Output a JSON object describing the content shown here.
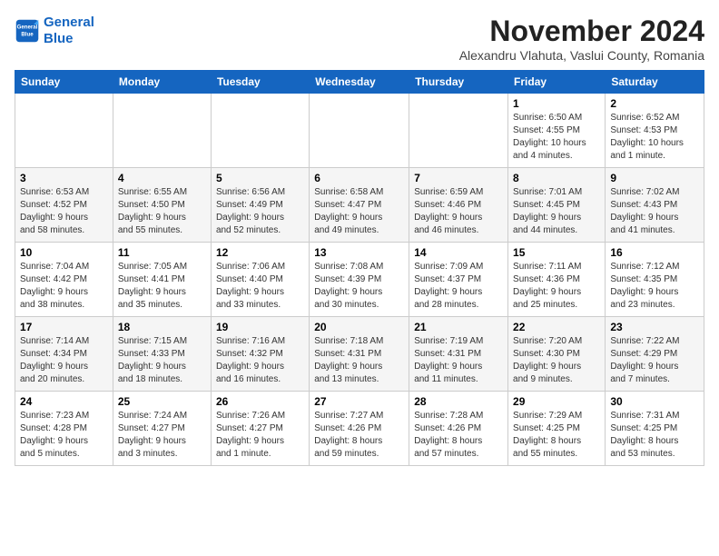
{
  "logo": {
    "line1": "General",
    "line2": "Blue"
  },
  "header": {
    "month": "November 2024",
    "location": "Alexandru Vlahuta, Vaslui County, Romania"
  },
  "weekdays": [
    "Sunday",
    "Monday",
    "Tuesday",
    "Wednesday",
    "Thursday",
    "Friday",
    "Saturday"
  ],
  "weeks": [
    [
      {
        "day": "",
        "detail": ""
      },
      {
        "day": "",
        "detail": ""
      },
      {
        "day": "",
        "detail": ""
      },
      {
        "day": "",
        "detail": ""
      },
      {
        "day": "",
        "detail": ""
      },
      {
        "day": "1",
        "detail": "Sunrise: 6:50 AM\nSunset: 4:55 PM\nDaylight: 10 hours\nand 4 minutes."
      },
      {
        "day": "2",
        "detail": "Sunrise: 6:52 AM\nSunset: 4:53 PM\nDaylight: 10 hours\nand 1 minute."
      }
    ],
    [
      {
        "day": "3",
        "detail": "Sunrise: 6:53 AM\nSunset: 4:52 PM\nDaylight: 9 hours\nand 58 minutes."
      },
      {
        "day": "4",
        "detail": "Sunrise: 6:55 AM\nSunset: 4:50 PM\nDaylight: 9 hours\nand 55 minutes."
      },
      {
        "day": "5",
        "detail": "Sunrise: 6:56 AM\nSunset: 4:49 PM\nDaylight: 9 hours\nand 52 minutes."
      },
      {
        "day": "6",
        "detail": "Sunrise: 6:58 AM\nSunset: 4:47 PM\nDaylight: 9 hours\nand 49 minutes."
      },
      {
        "day": "7",
        "detail": "Sunrise: 6:59 AM\nSunset: 4:46 PM\nDaylight: 9 hours\nand 46 minutes."
      },
      {
        "day": "8",
        "detail": "Sunrise: 7:01 AM\nSunset: 4:45 PM\nDaylight: 9 hours\nand 44 minutes."
      },
      {
        "day": "9",
        "detail": "Sunrise: 7:02 AM\nSunset: 4:43 PM\nDaylight: 9 hours\nand 41 minutes."
      }
    ],
    [
      {
        "day": "10",
        "detail": "Sunrise: 7:04 AM\nSunset: 4:42 PM\nDaylight: 9 hours\nand 38 minutes."
      },
      {
        "day": "11",
        "detail": "Sunrise: 7:05 AM\nSunset: 4:41 PM\nDaylight: 9 hours\nand 35 minutes."
      },
      {
        "day": "12",
        "detail": "Sunrise: 7:06 AM\nSunset: 4:40 PM\nDaylight: 9 hours\nand 33 minutes."
      },
      {
        "day": "13",
        "detail": "Sunrise: 7:08 AM\nSunset: 4:39 PM\nDaylight: 9 hours\nand 30 minutes."
      },
      {
        "day": "14",
        "detail": "Sunrise: 7:09 AM\nSunset: 4:37 PM\nDaylight: 9 hours\nand 28 minutes."
      },
      {
        "day": "15",
        "detail": "Sunrise: 7:11 AM\nSunset: 4:36 PM\nDaylight: 9 hours\nand 25 minutes."
      },
      {
        "day": "16",
        "detail": "Sunrise: 7:12 AM\nSunset: 4:35 PM\nDaylight: 9 hours\nand 23 minutes."
      }
    ],
    [
      {
        "day": "17",
        "detail": "Sunrise: 7:14 AM\nSunset: 4:34 PM\nDaylight: 9 hours\nand 20 minutes."
      },
      {
        "day": "18",
        "detail": "Sunrise: 7:15 AM\nSunset: 4:33 PM\nDaylight: 9 hours\nand 18 minutes."
      },
      {
        "day": "19",
        "detail": "Sunrise: 7:16 AM\nSunset: 4:32 PM\nDaylight: 9 hours\nand 16 minutes."
      },
      {
        "day": "20",
        "detail": "Sunrise: 7:18 AM\nSunset: 4:31 PM\nDaylight: 9 hours\nand 13 minutes."
      },
      {
        "day": "21",
        "detail": "Sunrise: 7:19 AM\nSunset: 4:31 PM\nDaylight: 9 hours\nand 11 minutes."
      },
      {
        "day": "22",
        "detail": "Sunrise: 7:20 AM\nSunset: 4:30 PM\nDaylight: 9 hours\nand 9 minutes."
      },
      {
        "day": "23",
        "detail": "Sunrise: 7:22 AM\nSunset: 4:29 PM\nDaylight: 9 hours\nand 7 minutes."
      }
    ],
    [
      {
        "day": "24",
        "detail": "Sunrise: 7:23 AM\nSunset: 4:28 PM\nDaylight: 9 hours\nand 5 minutes."
      },
      {
        "day": "25",
        "detail": "Sunrise: 7:24 AM\nSunset: 4:27 PM\nDaylight: 9 hours\nand 3 minutes."
      },
      {
        "day": "26",
        "detail": "Sunrise: 7:26 AM\nSunset: 4:27 PM\nDaylight: 9 hours\nand 1 minute."
      },
      {
        "day": "27",
        "detail": "Sunrise: 7:27 AM\nSunset: 4:26 PM\nDaylight: 8 hours\nand 59 minutes."
      },
      {
        "day": "28",
        "detail": "Sunrise: 7:28 AM\nSunset: 4:26 PM\nDaylight: 8 hours\nand 57 minutes."
      },
      {
        "day": "29",
        "detail": "Sunrise: 7:29 AM\nSunset: 4:25 PM\nDaylight: 8 hours\nand 55 minutes."
      },
      {
        "day": "30",
        "detail": "Sunrise: 7:31 AM\nSunset: 4:25 PM\nDaylight: 8 hours\nand 53 minutes."
      }
    ]
  ]
}
